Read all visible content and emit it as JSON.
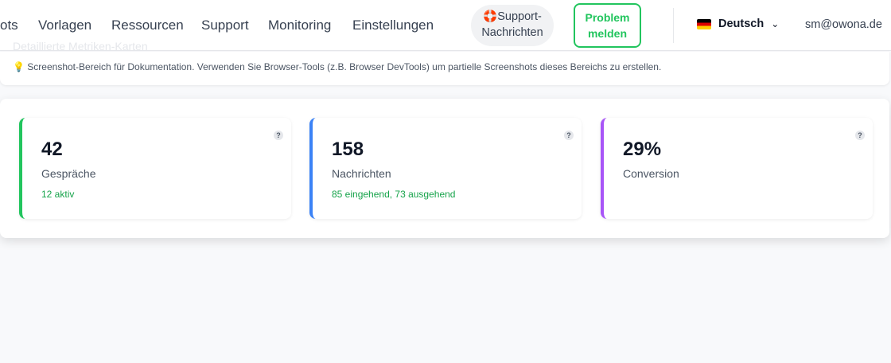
{
  "nav": {
    "links": [
      "ots",
      "Vorlagen",
      "Ressourcen",
      "Support",
      "Monitoring",
      "Einstellungen"
    ],
    "ghost_text": "Detaillierte Metriken-Karten",
    "support_button": "Support-Nachrichten",
    "support_icon": "lifebuoy-icon",
    "problem_button": "Problem melden",
    "language": "Deutsch",
    "user_email": "sm@owona.de",
    "accent": "#22c55e"
  },
  "info": {
    "icon": "lightbulb-icon",
    "text": "Screenshot-Bereich für Dokumentation. Verwenden Sie Browser-Tools (z.B. Browser DevTools) um partielle Screenshots dieses Bereichs zu erstellen."
  },
  "cards": [
    {
      "value": "42",
      "label": "Gespräche",
      "sub": "12 aktiv",
      "color": "#22c55e",
      "help": "?"
    },
    {
      "value": "158",
      "label": "Nachrichten",
      "sub": "85 eingehend, 73 ausgehend",
      "color": "#3b82f6",
      "help": "?"
    },
    {
      "value": "29%",
      "label": "Conversion",
      "sub": "",
      "color": "#a855f7",
      "help": "?"
    }
  ]
}
